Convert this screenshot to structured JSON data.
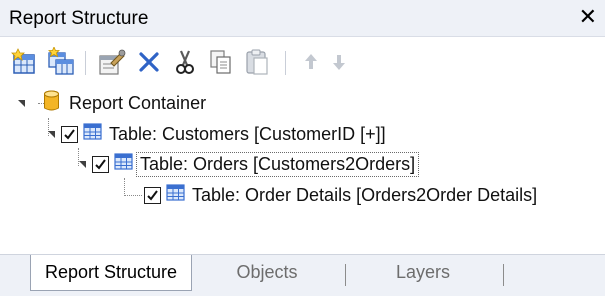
{
  "panel": {
    "title": "Report Structure",
    "close_glyph": "✕"
  },
  "toolbar": {
    "buttons": [
      {
        "name": "new-table-icon"
      },
      {
        "name": "new-subtable-icon"
      },
      {
        "name": "properties-icon"
      },
      {
        "name": "delete-icon"
      },
      {
        "name": "cut-icon"
      },
      {
        "name": "copy-icon"
      },
      {
        "name": "paste-icon"
      },
      {
        "name": "move-up-icon"
      },
      {
        "name": "move-down-icon"
      }
    ]
  },
  "tree": {
    "nodes": [
      {
        "label": "Report Container",
        "icon": "container-icon",
        "checked": null,
        "selected": false
      },
      {
        "label": "Table: Customers [CustomerID [+]]",
        "icon": "table-icon",
        "checked": true,
        "selected": false
      },
      {
        "label": "Table: Orders [Customers2Orders]",
        "icon": "table-icon",
        "checked": true,
        "selected": true
      },
      {
        "label": "Table: Order Details [Orders2Order Details]",
        "icon": "table-icon",
        "checked": true,
        "selected": false
      }
    ]
  },
  "tabs": [
    {
      "label": "Report Structure",
      "active": true
    },
    {
      "label": "Objects",
      "active": false
    },
    {
      "label": "Layers",
      "active": false
    }
  ],
  "colors": {
    "title_bg": "#eef1f7",
    "table_icon_blue": "#3a6fd0",
    "container_gold": "#f0b429"
  }
}
